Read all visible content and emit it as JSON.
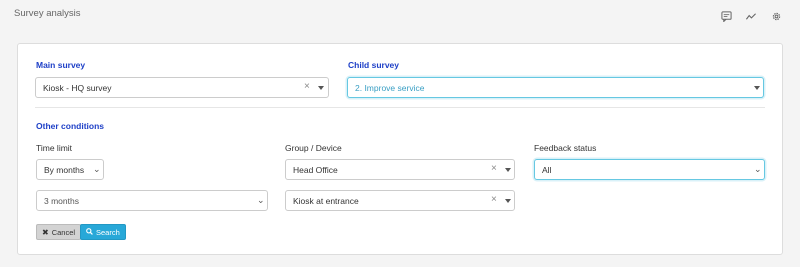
{
  "header": {
    "title": "Survey analysis",
    "icons": [
      "comment-icon",
      "trend-chart-icon",
      "gear-icon"
    ]
  },
  "main_survey": {
    "label": "Main survey",
    "value": "Kiosk - HQ survey"
  },
  "child_survey": {
    "label": "Child survey",
    "value": "2. Improve service"
  },
  "other_conditions": {
    "label": "Other conditions",
    "time_limit": {
      "label": "Time limit",
      "mode": "By months",
      "period": "3 months"
    },
    "group_device": {
      "label": "Group / Device",
      "group": "Head Office",
      "device": "Kiosk at entrance"
    },
    "feedback_status": {
      "label": "Feedback status",
      "value": "All"
    }
  },
  "actions": {
    "cancel_label": "Cancel",
    "search_label": "Search"
  },
  "colors": {
    "section_title": "#1d3fc7",
    "search_button": "#28a8d8",
    "focus_border": "#66c8e2"
  }
}
